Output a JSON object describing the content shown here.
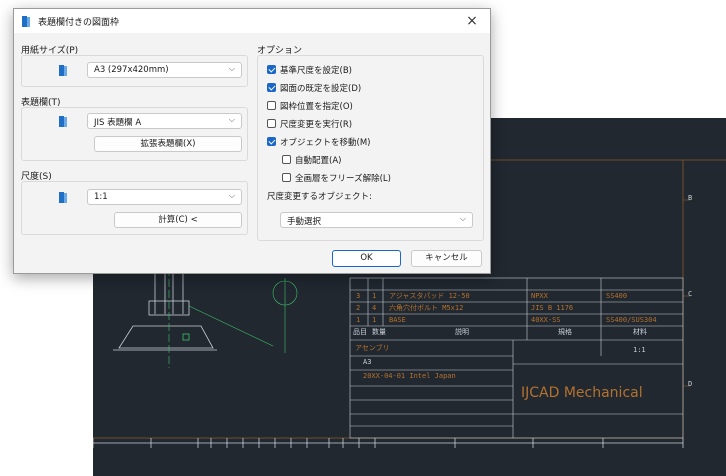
{
  "dialog": {
    "title": "表題欄付きの図面枠",
    "close_symbol": "×",
    "paper_size": {
      "label": "用紙サイズ(P)",
      "value": "A3 (297x420mm)"
    },
    "title_block": {
      "label": "表題欄(T)",
      "value": "JIS 表題欄 A",
      "extended_button": "拡張表題欄(X)"
    },
    "scale": {
      "label": "尺度(S)",
      "value": "1:1",
      "calc_button": "計算(C) <"
    },
    "options": {
      "label": "オプション",
      "items": [
        {
          "label": "基準尺度を設定(B)",
          "checked": true
        },
        {
          "label": "図面の既定を設定(D)",
          "checked": true
        },
        {
          "label": "図枠位置を指定(O)",
          "checked": false
        },
        {
          "label": "尺度変更を実行(R)",
          "checked": false
        },
        {
          "label": "オブジェクトを移動(M)",
          "checked": true
        },
        {
          "label": "自動配置(A)",
          "checked": false
        },
        {
          "label": "全画層をフリーズ解除(L)",
          "checked": false
        }
      ],
      "objects_label": "尺度変更するオブジェクト:",
      "objects_value": "手動選択"
    },
    "ok": "OK",
    "cancel": "キャンセル"
  },
  "cad": {
    "bom_rows": [
      {
        "no": "3",
        "qty": "1",
        "name": "アジャスタパッド 12-50",
        "code": "NPXX",
        "material": "SS400"
      },
      {
        "no": "2",
        "qty": "4",
        "name": "六角穴付ボルト M5x12",
        "code": "JIS B 1176",
        "material": ""
      },
      {
        "no": "1",
        "qty": "1",
        "name": "BASE",
        "code": "40XX-SS",
        "material": "SS400/SUS304"
      }
    ],
    "bom_header": {
      "no": "品目",
      "qty": "数量",
      "name": "説明",
      "code": "規格",
      "material": "材料"
    },
    "titleblock_left": [
      "アセンブリ",
      "A3",
      "20XX-04-01 Intel Japan"
    ],
    "scale_value": "1:1",
    "company": "IJCAD Mechanical"
  }
}
